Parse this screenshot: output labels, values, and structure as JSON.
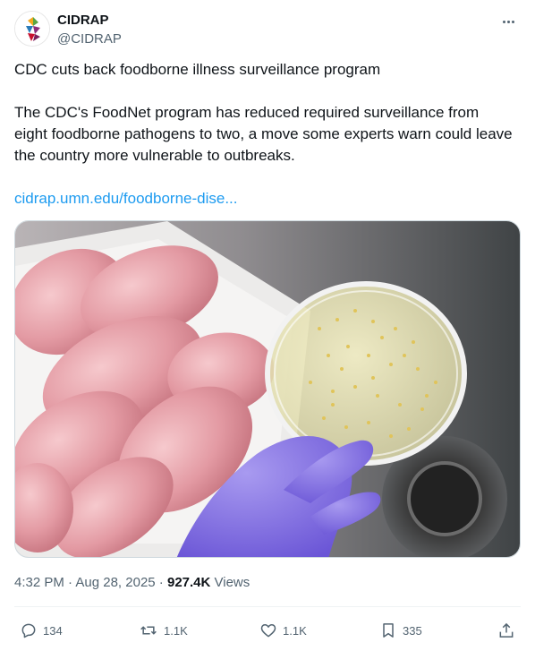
{
  "account": {
    "display_name": "CIDRAP",
    "handle": "@CIDRAP"
  },
  "post": {
    "headline": "CDC cuts back foodborne illness surveillance program",
    "body": "The CDC's FoodNet program has reduced required surveillance from eight foodborne pathogens to two, a move some experts warn could leave the country more vulnerable to outbreaks.",
    "link_text": "cidrap.umn.edu/foodborne-dise..."
  },
  "meta": {
    "time": "4:32 PM",
    "separator": " · ",
    "date": "Aug 28, 2025",
    "views_count": "927.4K",
    "views_label": " Views"
  },
  "actions": {
    "replies": "134",
    "reposts": "1.1K",
    "likes": "1.1K",
    "bookmarks": "335"
  },
  "icons": {
    "more": "more-dots-icon",
    "reply": "reply-icon",
    "repost": "repost-icon",
    "like": "heart-icon",
    "bookmark": "bookmark-icon",
    "share": "share-icon"
  },
  "colors": {
    "link": "#1d9bf0",
    "secondary_text": "#536471",
    "primary_text": "#0f1419"
  }
}
